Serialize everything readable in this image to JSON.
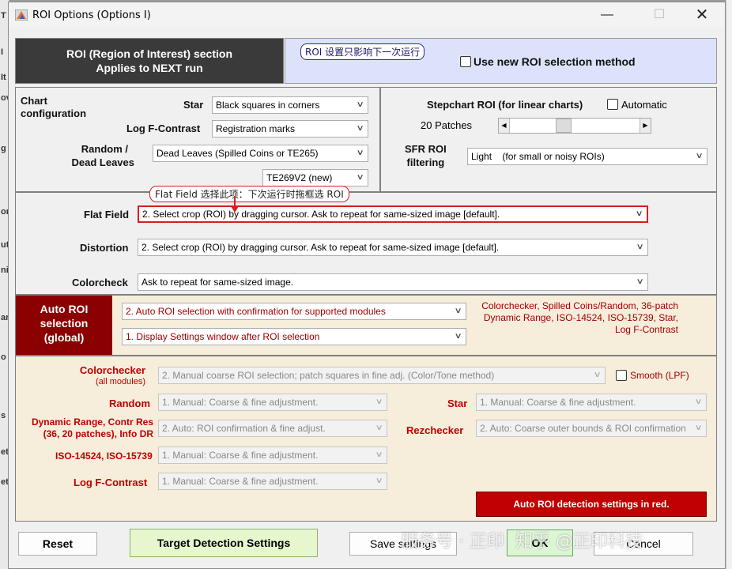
{
  "window": {
    "title": "ROI Options (Options I)"
  },
  "header": {
    "line1": "ROI (Region of Interest) section",
    "line2": "Applies to NEXT run",
    "annotation": "ROI 设置只影响下一次运行",
    "new_roi_label": "Use new ROI selection method"
  },
  "chart_config": {
    "title_line1": "Chart",
    "title_line2": "configuration",
    "star_label": "Star",
    "star_value": "Black squares in corners",
    "logf_label": "Log F-Contrast",
    "logf_value": "Registration marks",
    "random_label1": "Random /",
    "random_label2": "Dead Leaves",
    "random_value": "Dead Leaves (Spilled Coins or TE265)",
    "te_value": "TE269V2 (new)"
  },
  "stepchart": {
    "label": "Stepchart ROI (for linear charts)",
    "automatic_label": "Automatic",
    "patches_label": "20 Patches",
    "slider_level_percent": 40,
    "sfr_label1": "SFR ROI",
    "sfr_label2": "filtering",
    "sfr_value": "Light    (for small or noisy ROIs)"
  },
  "flat_annotation": "Flat Field 选择此项：下次运行时拖框选 ROI",
  "flat": {
    "label": "Flat Field",
    "value": "2. Select crop (ROI) by dragging cursor. Ask to repeat for same-sized image [default]."
  },
  "distortion": {
    "label": "Distortion",
    "value": "2. Select crop (ROI) by dragging cursor. Ask to repeat for same-sized image [default]."
  },
  "colorcheck": {
    "label": "Colorcheck",
    "value": "Ask to repeat for same-sized image."
  },
  "auto_roi": {
    "title1": "Auto ROI",
    "title2": "selection",
    "title3": "(global)",
    "select1": "2. Auto ROI selection with confirmation for supported modules",
    "select2": "1. Display Settings window after  ROI selection",
    "note1": "Colorchecker, Spilled Coins/Random, 36-patch",
    "note2": "Dynamic Range, ISO-14524, ISO-15739, Star,",
    "note3": "Log F-Contrast"
  },
  "modules": {
    "colorchecker_label": "Colorchecker",
    "colorchecker_sub": "(all modules)",
    "colorchecker_value": "2. Manual coarse ROI selection; patch squares in fine adj. (Color/Tone method)",
    "smooth_label": "Smooth (LPF)",
    "random_label": "Random",
    "random_value": "1. Manual:  Coarse & fine adjustment.",
    "star_label": "Star",
    "star_value": "1. Manual:  Coarse & fine adjustment.",
    "dr_label1": "Dynamic Range, Contr Res",
    "dr_label2": "(36, 20 patches), Info DR",
    "dr_value": "2. Auto:  ROI confirmation & fine adjust.",
    "rez_label": "Rezchecker",
    "rez_value": "2. Auto:  Coarse outer bounds & ROI confirmation",
    "iso_label": "ISO-14524, ISO-15739",
    "iso_value": "1. Manual:  Coarse & fine adjustment.",
    "logf_label": "Log F-Contrast",
    "logf_value": "1. Manual:  Coarse & fine adjustment.",
    "auto_roi_note": "Auto ROI detection settings in red."
  },
  "buttons": {
    "reset": "Reset",
    "target": "Target Detection Settings",
    "save": "Save settings",
    "ok": "OK",
    "cancel": "Cancel"
  },
  "watermark": "服务号 · 正印  知乎 @正印科技",
  "background_app_letters": [
    "T",
    "I",
    "It",
    "ov",
    "g",
    "or",
    "ut",
    "ni",
    "ar",
    "o",
    "s",
    "et",
    "et"
  ],
  "colors": {
    "header_dark": "#3a3a3a",
    "header_blue": "#dbe2fa",
    "auto_roi_red": "#8b0000",
    "module_bg": "#f6eddb",
    "target_green": "#e6f7cf",
    "highlight_red": "#d61f1f"
  }
}
